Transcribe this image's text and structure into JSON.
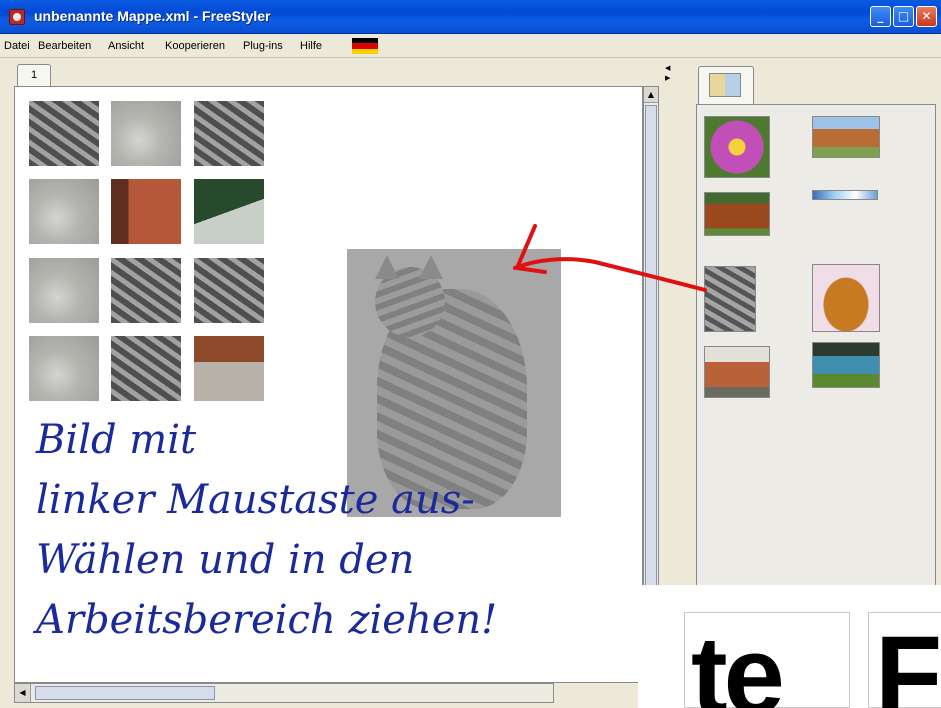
{
  "window": {
    "title": "unbenannte Mappe.xml - FreeStyler",
    "buttons": {
      "minimize": "_",
      "maximize": "□",
      "close": "✕"
    }
  },
  "menu": {
    "items": [
      "Datei",
      "Bearbeiten",
      "Ansicht",
      "Kooperieren",
      "Plug-ins",
      "Hilfe"
    ],
    "language_flag": "german-flag-icon"
  },
  "canvas": {
    "tab_label": "1",
    "handwritten_note": [
      "Bild mit",
      "linker Maustaste aus-",
      "Wählen und in den",
      "Arbeitsbereich ziehen!"
    ]
  },
  "library": {
    "tab_icon": "puzzle-icon",
    "images": [
      "flower",
      "cow",
      "highland-cattle",
      "banner",
      "cat",
      "dog",
      "horse",
      "painted-cow"
    ]
  },
  "zoom_overlay": {
    "left_text": "te",
    "right_text": "F"
  },
  "colors": {
    "titlebar": "#0a5be0",
    "menubar": "#ece9d8",
    "handwriting": "#1a2a9c",
    "arrow": "#e01010"
  }
}
